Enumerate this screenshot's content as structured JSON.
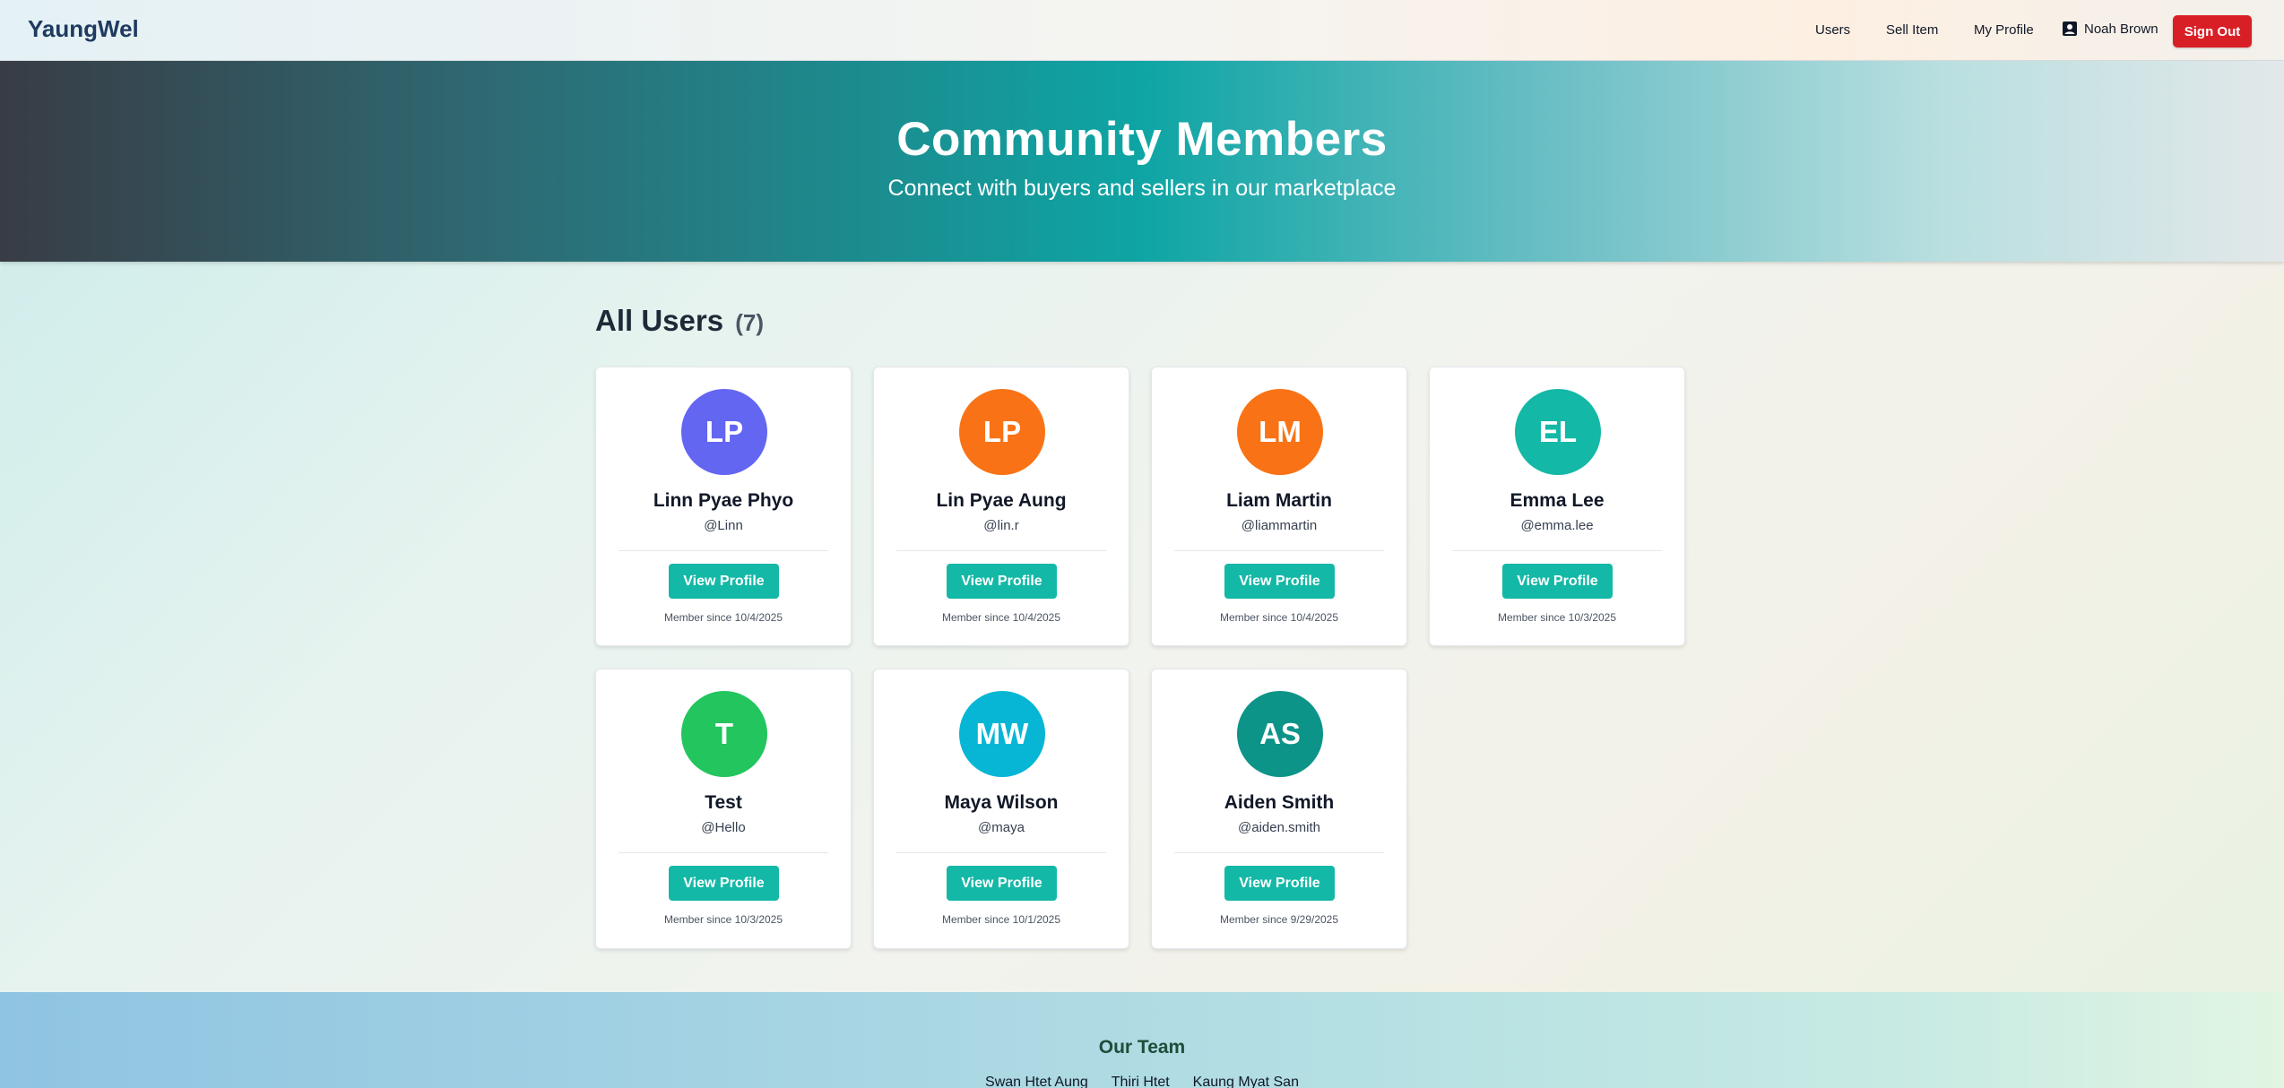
{
  "header": {
    "brand": "YaungWel",
    "nav": {
      "users": "Users",
      "sell_item": "Sell Item",
      "my_profile": "My Profile",
      "current_user": "Noah Brown",
      "sign_out": "Sign Out"
    }
  },
  "hero": {
    "title": "Community Members",
    "subtitle": "Connect with buyers and sellers in our marketplace"
  },
  "section": {
    "title": "All Users",
    "count": "(7)"
  },
  "users": [
    {
      "initials": "LP",
      "name": "Linn Pyae Phyo",
      "handle": "@Linn",
      "button": "View Profile",
      "member_since": "Member since 10/4/2025",
      "color": "#6366f1"
    },
    {
      "initials": "LP",
      "name": "Lin Pyae Aung",
      "handle": "@lin.r",
      "button": "View Profile",
      "member_since": "Member since 10/4/2025",
      "color": "#f97316"
    },
    {
      "initials": "LM",
      "name": "Liam Martin",
      "handle": "@liammartin",
      "button": "View Profile",
      "member_since": "Member since 10/4/2025",
      "color": "#f97316"
    },
    {
      "initials": "EL",
      "name": "Emma Lee",
      "handle": "@emma.lee",
      "button": "View Profile",
      "member_since": "Member since 10/3/2025",
      "color": "#14b8a6"
    },
    {
      "initials": "T",
      "name": "Test",
      "handle": "@Hello",
      "button": "View Profile",
      "member_since": "Member since 10/3/2025",
      "color": "#22c55e"
    },
    {
      "initials": "MW",
      "name": "Maya Wilson",
      "handle": "@maya",
      "button": "View Profile",
      "member_since": "Member since 10/1/2025",
      "color": "#06b6d4"
    },
    {
      "initials": "AS",
      "name": "Aiden Smith",
      "handle": "@aiden.smith",
      "button": "View Profile",
      "member_since": "Member since 9/29/2025",
      "color": "#0d9488"
    }
  ],
  "footer": {
    "title": "Our Team",
    "members": [
      "Swan Htet Aung",
      "Thiri Htet",
      "Kaung Myat San"
    ]
  },
  "colors": {
    "accent": "#14b8a6",
    "sign_out": "#d91f26",
    "brand": "#1e3a5f"
  }
}
